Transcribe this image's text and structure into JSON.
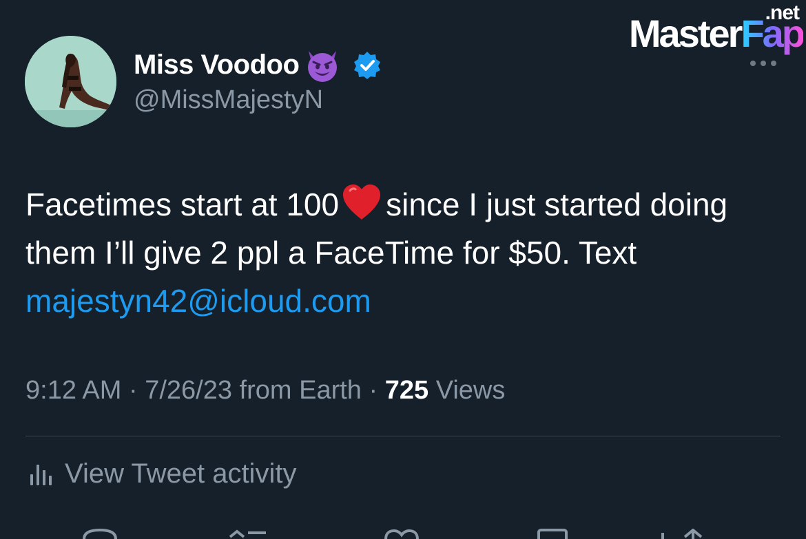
{
  "watermark": {
    "tld": ".net",
    "brand_a": "Master",
    "brand_b": "Fap"
  },
  "author": {
    "display_name": "Miss Voodoo",
    "handle": "@MissMajestyN",
    "verified": true
  },
  "tweet": {
    "part1": "Facetimes start at 100",
    "part2": "since I just started doing them I’ll give 2 ppl a FaceTime for $50. Text ",
    "link": "majestyn42@icloud.com"
  },
  "meta": {
    "time": "9:12 AM",
    "sep1": " · ",
    "date": "7/26/23",
    "source": " from Earth",
    "sep2": " · ",
    "views_count": "725",
    "views_label": " Views"
  },
  "activity": {
    "label": "View Tweet activity"
  },
  "icons": {
    "more": "more-options-icon",
    "verified": "verified-badge-icon",
    "activity": "bar-chart-icon",
    "reply": "reply-icon",
    "retweet": "retweet-icon",
    "like": "heart-icon",
    "bookmark": "bookmark-icon",
    "share": "share-icon"
  },
  "colors": {
    "background": "#15202b",
    "link": "#1d9bf0",
    "muted": "#8b98a5",
    "verified": "#1d9bf0"
  }
}
